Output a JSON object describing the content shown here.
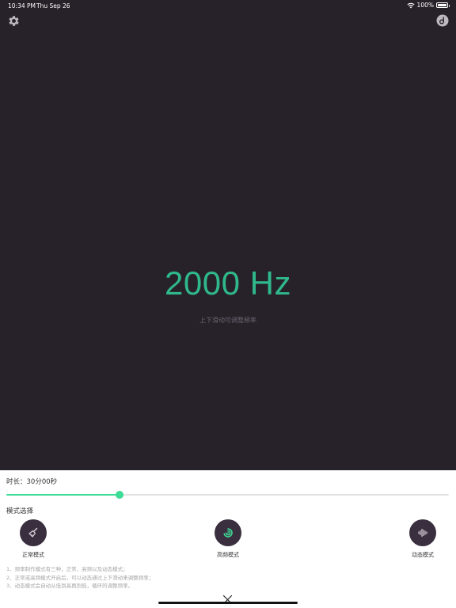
{
  "status_bar": {
    "time": "10:34 PM",
    "date": "Thu Sep 26",
    "battery_pct": "100%",
    "wifi_icon": "wifi-icon",
    "battery_icon": "battery-icon"
  },
  "toolbar": {
    "settings_icon": "gear-icon",
    "music_icon": "music-disc-icon"
  },
  "frequency": {
    "value": "2000 Hz",
    "hint": "上下滑动可调整频率",
    "color": "#2fb88a"
  },
  "duration": {
    "label": "时长：30分00秒",
    "progress": 0.255,
    "accent": "#3ddc97"
  },
  "modes": {
    "title": "模式选择",
    "items": [
      {
        "label": "正常模式",
        "icon": "broom-icon"
      },
      {
        "label": "高频模式",
        "icon": "swirl-icon"
      },
      {
        "label": "动态模式",
        "icon": "sound-wave-icon"
      }
    ]
  },
  "notes": [
    "1、频率制作模式有三种，正常、高频以及动态模式；",
    "2、正常或高频模式开启后，可以动态通过上下滑动来调整频率；",
    "3、动态模式会自动从低到高再到低，循环的调整频率。"
  ],
  "close_icon": "close-icon",
  "colors": {
    "background_dark": "#27212a",
    "mode_button_bg": "#3a2f3e"
  }
}
